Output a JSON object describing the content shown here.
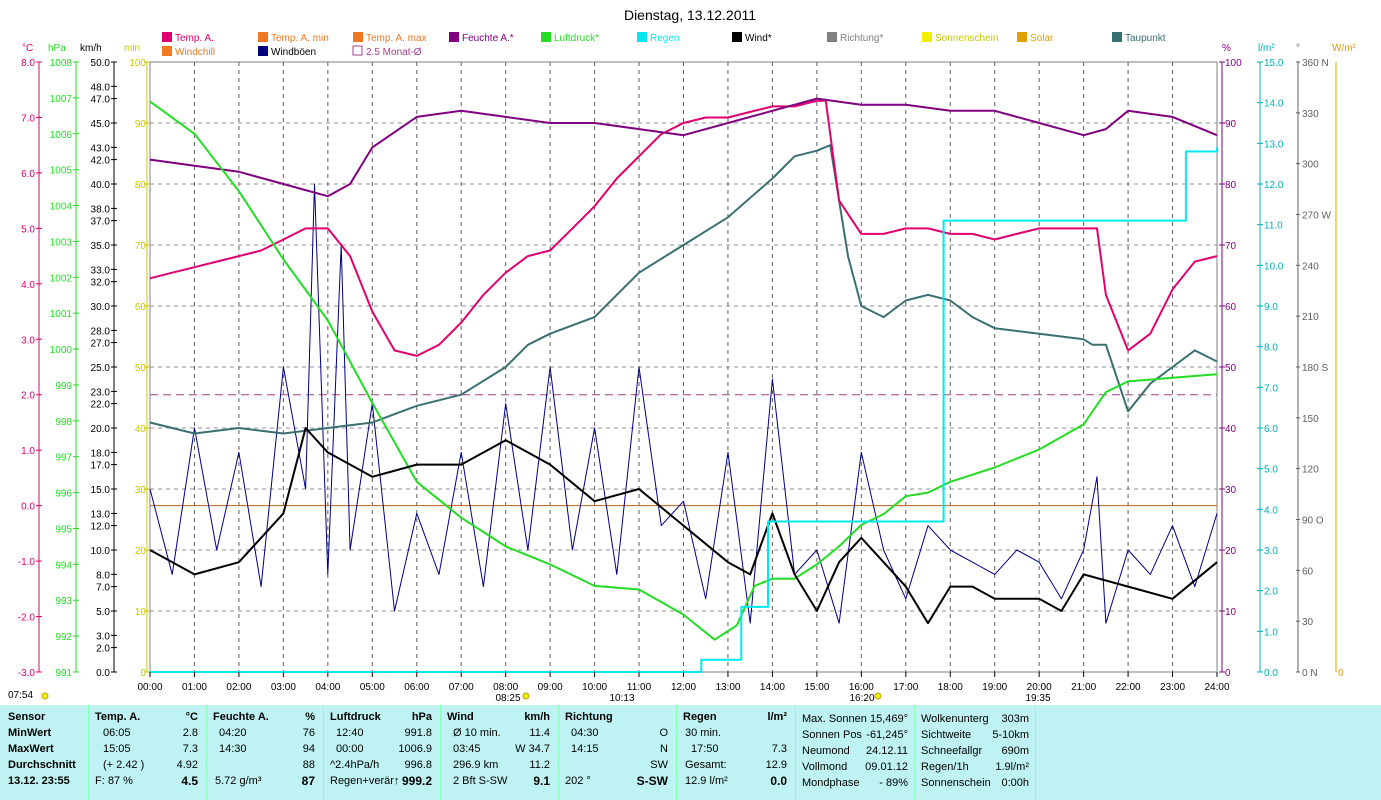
{
  "title": "Dienstag, 13.12.2011",
  "colors": {
    "temp": "#e0006e",
    "temp_min": "#f07820",
    "temp_max": "#f07820",
    "humidity": "#800080",
    "pressure": "#22dd22",
    "rain": "#00e8f0",
    "wind": "#000000",
    "gusts": "#000080",
    "direction": "#808080",
    "sunshine": "#f0f000",
    "solar": "#e0a000",
    "dewpoint": "#3a7070",
    "windchill": "#f07820",
    "avg_line": "#a0408f"
  },
  "legend": {
    "row1": [
      "Temp. A.",
      "Temp. A. min",
      "Temp. A. max",
      "Feuchte A.*",
      "Luftdruck*",
      "Regen",
      "Wind*",
      "Richtung*",
      "Sonnenschein",
      "Solar",
      "Taupunkt"
    ],
    "row2": [
      "Windchill",
      "Windböen",
      "2.5 Monat-Ø"
    ]
  },
  "axis_units": {
    "temp": "°C",
    "pressure": "hPa",
    "wind": "km/h",
    "min": "min",
    "humidity": "%",
    "rain": "l/m²",
    "direction": "°",
    "solar": "W/m²"
  },
  "axes": {
    "temp_ticks": [
      "8.0",
      "7.0",
      "6.0",
      "5.0",
      "4.0",
      "3.0",
      "2.0",
      "1.0",
      "0.0",
      "-1.0",
      "-2.0",
      "-3.0"
    ],
    "pressure_ticks": [
      "1008",
      "1007",
      "1006",
      "1005",
      "1004",
      "1003",
      "1002",
      "1001",
      "1000",
      "999",
      "998",
      "997",
      "996",
      "995",
      "994",
      "993",
      "992",
      "991"
    ],
    "wind_ticks": [
      "50.0",
      "48.0",
      "47.0",
      "45.0",
      "43.0",
      "42.0",
      "40.0",
      "38.0",
      "37.0",
      "35.0",
      "33.0",
      "32.0",
      "30.0",
      "28.0",
      "27.0",
      "25.0",
      "23.0",
      "22.0",
      "20.0",
      "18.0",
      "17.0",
      "15.0",
      "13.0",
      "12.0",
      "10.0",
      "8.0",
      "7.0",
      "5.0",
      "3.0",
      "2.0",
      "0.0"
    ],
    "min_ticks": [
      "100",
      "90",
      "80",
      "70",
      "60",
      "50",
      "40",
      "30",
      "20",
      "10",
      "0"
    ],
    "humidity_ticks": [
      "100",
      "90",
      "80",
      "70",
      "60",
      "50",
      "40",
      "30",
      "20",
      "10",
      "0"
    ],
    "rain_ticks": [
      "15.0",
      "14.0",
      "13.0",
      "12.0",
      "11.0",
      "10.0",
      "9.0",
      "8.0",
      "7.0",
      "6.0",
      "5.0",
      "4.0",
      "3.0",
      "2.0",
      "1.0",
      "0.0"
    ],
    "direction_ticks": [
      "360 N",
      "330",
      "300",
      "270 W",
      "240",
      "210",
      "180 S",
      "150",
      "120",
      "90 O",
      "60",
      "30",
      "0 N"
    ],
    "solar_ticks": [
      "0"
    ],
    "time_ticks": [
      "00:00",
      "01:00",
      "02:00",
      "03:00",
      "04:00",
      "05:00",
      "06:00",
      "07:00",
      "08:00",
      "09:00",
      "10:00",
      "11:00",
      "12:00",
      "13:00",
      "14:00",
      "15:00",
      "16:00",
      "17:00",
      "18:00",
      "19:00",
      "20:00",
      "21:00",
      "22:00",
      "23:00",
      "24:00"
    ],
    "sun_markers": [
      "07:54",
      "08:25",
      "10:13",
      "16:20",
      "19:35"
    ]
  },
  "chart_data": {
    "type": "line",
    "title": "Dienstag, 13.12.2011",
    "x_unit": "hour",
    "xlim": [
      0,
      24
    ],
    "ylim_temp": [
      -3,
      8
    ],
    "ylim_pressure": [
      991,
      1008
    ],
    "ylim_wind": [
      0,
      50
    ],
    "ylim_humidity": [
      0,
      100
    ],
    "ylim_rain": [
      0,
      15
    ],
    "series": [
      {
        "name": "Temp. A.",
        "unit": "°C",
        "x": [
          0,
          0.5,
          1,
          1.5,
          2,
          2.5,
          3,
          3.5,
          4,
          4.5,
          5,
          5.5,
          6,
          6.5,
          7,
          7.5,
          8,
          8.5,
          9,
          9.5,
          10,
          10.5,
          11,
          11.5,
          12,
          12.5,
          13,
          13.5,
          14,
          14.5,
          15,
          15.2,
          15.5,
          16,
          16.5,
          17,
          17.5,
          18,
          18.5,
          19,
          19.5,
          20,
          20.5,
          21,
          21.3,
          21.5,
          22,
          22.5,
          23,
          23.5,
          24
        ],
        "values": [
          4.1,
          4.2,
          4.3,
          4.4,
          4.5,
          4.6,
          4.8,
          5.0,
          5.0,
          4.5,
          3.5,
          2.8,
          2.7,
          2.9,
          3.3,
          3.8,
          4.2,
          4.5,
          4.6,
          5.0,
          5.4,
          5.9,
          6.3,
          6.7,
          6.9,
          7.0,
          7.0,
          7.1,
          7.2,
          7.2,
          7.3,
          7.3,
          5.5,
          4.9,
          4.9,
          5.0,
          5.0,
          4.9,
          4.9,
          4.8,
          4.9,
          5.0,
          5.0,
          5.0,
          5.0,
          3.8,
          2.8,
          3.1,
          3.9,
          4.4,
          4.5
        ]
      },
      {
        "name": "Feuchte A.*",
        "unit": "%",
        "x": [
          0,
          1,
          2,
          3,
          3.5,
          4,
          4.5,
          5,
          6,
          7,
          8,
          9,
          10,
          11,
          12,
          13,
          14,
          15,
          16,
          17,
          18,
          19,
          20,
          21,
          21.5,
          22,
          23,
          24
        ],
        "values": [
          84,
          83,
          82,
          80,
          79,
          78,
          80,
          86,
          91,
          92,
          91,
          90,
          90,
          89,
          88,
          90,
          92,
          94,
          93,
          93,
          92,
          92,
          90,
          88,
          89,
          92,
          91,
          88
        ]
      },
      {
        "name": "Luftdruck*",
        "unit": "hPa",
        "x": [
          0,
          1,
          2,
          3,
          4,
          5,
          6,
          7,
          8,
          9,
          10,
          11,
          12,
          12.7,
          13.2,
          13.6,
          14,
          14.5,
          15,
          15.5,
          16,
          16.5,
          17,
          17.5,
          18,
          19,
          20,
          21,
          21.5,
          22,
          23,
          24
        ],
        "values": [
          1006.9,
          1006.0,
          1004.4,
          1002.5,
          1000.8,
          998.5,
          996.3,
          995.3,
          994.5,
          994.0,
          993.4,
          993.3,
          992.6,
          991.9,
          992.3,
          993.4,
          993.6,
          993.6,
          994.0,
          994.5,
          995.1,
          995.4,
          995.9,
          996.0,
          996.3,
          996.7,
          997.2,
          997.9,
          998.8,
          999.1,
          999.2,
          999.3
        ]
      },
      {
        "name": "Regen",
        "unit": "l/m²",
        "x": [
          0,
          12.3,
          12.4,
          13.2,
          13.3,
          13.8,
          13.9,
          17.8,
          17.85,
          23.2,
          23.3,
          23.9,
          24
        ],
        "values": [
          0,
          0,
          0.3,
          0.3,
          1.6,
          1.6,
          3.7,
          3.7,
          11.1,
          11.1,
          12.8,
          12.8,
          12.9
        ]
      },
      {
        "name": "Taupunkt",
        "unit": "°C",
        "x": [
          0,
          1,
          2,
          3,
          4,
          5,
          6,
          7,
          8,
          8.5,
          9,
          10,
          11,
          12,
          13,
          14,
          14.5,
          15,
          15.3,
          15.7,
          16,
          16.5,
          17,
          17.5,
          18,
          18.5,
          19,
          20,
          21,
          21.2,
          21.5,
          22,
          22.5,
          23,
          23.5,
          24
        ],
        "values": [
          1.5,
          1.3,
          1.4,
          1.3,
          1.4,
          1.5,
          1.8,
          2.0,
          2.5,
          2.9,
          3.1,
          3.4,
          4.2,
          4.7,
          5.2,
          5.9,
          6.3,
          6.4,
          6.5,
          4.5,
          3.6,
          3.4,
          3.7,
          3.8,
          3.7,
          3.4,
          3.2,
          3.1,
          3.0,
          2.9,
          2.9,
          1.7,
          2.2,
          2.5,
          2.8,
          2.6
        ]
      },
      {
        "name": "Wind*",
        "unit": "km/h",
        "x": [
          0,
          1,
          2,
          3,
          3.5,
          4,
          5,
          6,
          7,
          8,
          8.5,
          9,
          10,
          11,
          12,
          13,
          13.5,
          14,
          14.5,
          15,
          15.5,
          16,
          16.5,
          17,
          17.5,
          18,
          18.5,
          19,
          20,
          20.5,
          21,
          22,
          23,
          24
        ],
        "values": [
          10,
          8,
          9,
          13,
          20,
          18,
          16,
          17,
          17,
          19,
          18,
          17,
          14,
          15,
          12,
          9,
          8,
          13,
          8,
          5,
          9,
          11,
          9,
          7,
          4,
          7,
          7,
          6,
          6,
          5,
          8,
          7,
          6,
          9
        ]
      },
      {
        "name": "Windböen",
        "unit": "km/h",
        "x": [
          0,
          0.5,
          1,
          1.5,
          2,
          2.5,
          3,
          3.5,
          3.7,
          4,
          4.3,
          4.5,
          5,
          5.5,
          6,
          6.5,
          7,
          7.5,
          8,
          8.5,
          9,
          9.5,
          10,
          10.5,
          11,
          11.5,
          12,
          12.5,
          13,
          13.5,
          14,
          14.5,
          15,
          15.5,
          16,
          16.5,
          17,
          17.5,
          18,
          18.5,
          19,
          19.5,
          20,
          20.5,
          21,
          21.3,
          21.5,
          22,
          22.5,
          23,
          23.5,
          24
        ],
        "values": [
          15,
          8,
          20,
          10,
          18,
          7,
          25,
          15,
          40,
          8,
          35,
          10,
          22,
          5,
          13,
          8,
          18,
          7,
          22,
          10,
          25,
          10,
          20,
          8,
          25,
          12,
          14,
          6,
          18,
          4,
          24,
          8,
          10,
          4,
          18,
          10,
          6,
          12,
          10,
          9,
          8,
          10,
          9,
          6,
          10,
          16,
          4,
          10,
          8,
          12,
          7,
          13
        ]
      }
    ],
    "reference_lines": [
      {
        "name": "2.5 Monat-Ø",
        "axis": "temp",
        "value": 2.0
      }
    ]
  },
  "stats": {
    "sensor": {
      "title": "Sensor",
      "rows": [
        "MinWert",
        "MaxWert",
        "Durchschnitt",
        "13.12. 23:55"
      ]
    },
    "temp": {
      "title": "Temp. A.",
      "unit": "°C",
      "r1": [
        "06:05",
        "2.8"
      ],
      "r2": [
        "15:05",
        "7.3"
      ],
      "r3": [
        "(+ 2.42 )",
        "4.92"
      ],
      "r4": [
        "F: 87 %",
        "4.5"
      ]
    },
    "humidity": {
      "title": "Feuchte A.",
      "unit": "%",
      "r1": [
        "04:20",
        "76"
      ],
      "r2": [
        "14:30",
        "94"
      ],
      "r3": [
        "",
        "88"
      ],
      "r4": [
        "5.72 g/m³",
        "87"
      ]
    },
    "pressure": {
      "title": "Luftdruck",
      "unit": "hPa",
      "r1": [
        "12:40",
        "991.8"
      ],
      "r2": [
        "00:00",
        "1006.9"
      ],
      "r3": [
        "^2.4hPa/h",
        "996.8"
      ],
      "r4": [
        "Regen+verär↑",
        "999.2"
      ]
    },
    "wind": {
      "title": "Wind",
      "unit": "km/h",
      "r1": [
        "Ø 10 min.",
        "11.4"
      ],
      "r2": [
        "03:45",
        "W 34.7"
      ],
      "r3": [
        "296.9 km",
        "11.2"
      ],
      "r4": [
        "2 Bft S-SW",
        "9.1"
      ]
    },
    "direction": {
      "title": "Richtung",
      "r1": [
        "04:30",
        "O"
      ],
      "r2": [
        "14:15",
        "N"
      ],
      "r3": [
        "",
        "SW"
      ],
      "r4": [
        "202 °",
        "S-SW"
      ]
    },
    "rain": {
      "title": "Regen",
      "unit": "l/m²",
      "r1": [
        "30 min.",
        ""
      ],
      "r2": [
        "17:50",
        "7.3"
      ],
      "r3": [
        "Gesamt:",
        "12.9"
      ],
      "r4": [
        "12.9 l/m²",
        "0.0"
      ]
    },
    "astro": {
      "r1": [
        "Max. Sonnen",
        "15,469°"
      ],
      "r2": [
        "Sonnen Pos",
        "-61,245°"
      ],
      "r3": [
        "Neumond",
        "24.12.11"
      ],
      "r4": [
        "Vollmond",
        "09.01.12"
      ],
      "r5": [
        "Mondphase",
        "- 89%"
      ]
    },
    "misc": {
      "r1": [
        "Wolkenunterg",
        "303m"
      ],
      "r2": [
        "Sichtweite",
        "5-10km"
      ],
      "r3": [
        "Schneefallgr",
        "690m"
      ],
      "r4": [
        "Regen/1h",
        "1.9l/m²"
      ],
      "r5": [
        "Sonnenschein",
        "0:00h"
      ]
    }
  }
}
